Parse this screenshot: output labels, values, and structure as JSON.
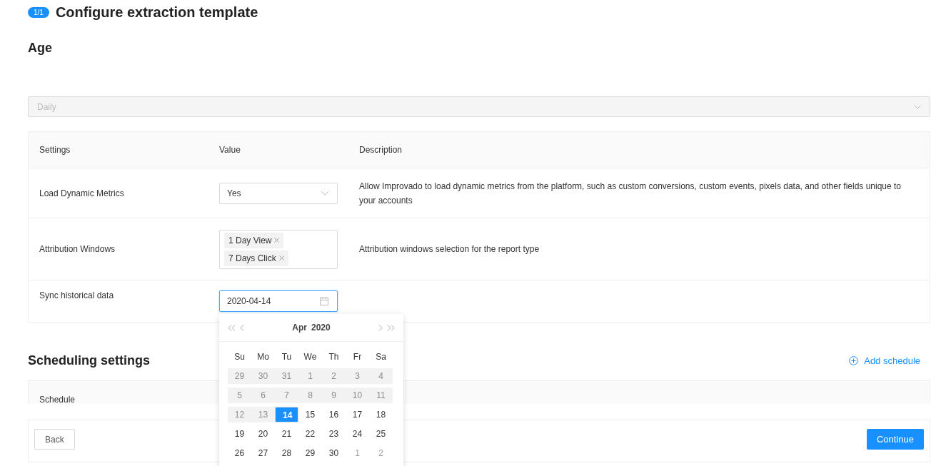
{
  "header": {
    "badge": "1/1",
    "title": "Configure extraction template"
  },
  "section_title": "Age",
  "frequency_select": {
    "value": "Daily",
    "disabled": true
  },
  "settings_table": {
    "columns": [
      "Settings",
      "Value",
      "Description"
    ],
    "rows": [
      {
        "kind": "select",
        "setting": "Load Dynamic Metrics",
        "value": "Yes",
        "description": "Allow Improvado to load dynamic metrics from the platform, such as custom conversions, custom events, pixels data, and other fields unique to your accounts"
      },
      {
        "kind": "tags",
        "setting": "Attribution Windows",
        "tags": [
          "1 Day View",
          "7 Days Click"
        ],
        "description": "Attribution windows selection for the report type"
      },
      {
        "kind": "date",
        "setting": "Sync historical data",
        "value": "2020-04-14"
      }
    ]
  },
  "date_picker": {
    "month": "Apr",
    "year": "2020",
    "weekdays": [
      "Su",
      "Mo",
      "Tu",
      "We",
      "Th",
      "Fr",
      "Sa"
    ],
    "weeks": [
      [
        {
          "day": "29",
          "disabled": true,
          "selected": false
        },
        {
          "day": "30",
          "disabled": true,
          "selected": false
        },
        {
          "day": "31",
          "disabled": true,
          "selected": false
        },
        {
          "day": "1",
          "disabled": true,
          "selected": false
        },
        {
          "day": "2",
          "disabled": true,
          "selected": false
        },
        {
          "day": "3",
          "disabled": true,
          "selected": false
        },
        {
          "day": "4",
          "disabled": true,
          "selected": false
        }
      ],
      [
        {
          "day": "5",
          "disabled": true,
          "selected": false
        },
        {
          "day": "6",
          "disabled": true,
          "selected": false
        },
        {
          "day": "7",
          "disabled": true,
          "selected": false
        },
        {
          "day": "8",
          "disabled": true,
          "selected": false
        },
        {
          "day": "9",
          "disabled": true,
          "selected": false
        },
        {
          "day": "10",
          "disabled": true,
          "selected": false
        },
        {
          "day": "11",
          "disabled": true,
          "selected": false
        }
      ],
      [
        {
          "day": "12",
          "disabled": true,
          "selected": false
        },
        {
          "day": "13",
          "disabled": true,
          "selected": false
        },
        {
          "day": "14",
          "disabled": false,
          "other_month": false,
          "selected": true
        },
        {
          "day": "15",
          "disabled": false,
          "other_month": false,
          "selected": false
        },
        {
          "day": "16",
          "disabled": false,
          "other_month": false,
          "selected": false
        },
        {
          "day": "17",
          "disabled": false,
          "other_month": false,
          "selected": false
        },
        {
          "day": "18",
          "disabled": false,
          "other_month": false,
          "selected": false
        }
      ],
      [
        {
          "day": "19",
          "disabled": false,
          "other_month": false,
          "selected": false
        },
        {
          "day": "20",
          "disabled": false,
          "other_month": false,
          "selected": false
        },
        {
          "day": "21",
          "disabled": false,
          "other_month": false,
          "selected": false
        },
        {
          "day": "22",
          "disabled": false,
          "other_month": false,
          "selected": false
        },
        {
          "day": "23",
          "disabled": false,
          "other_month": false,
          "selected": false
        },
        {
          "day": "24",
          "disabled": false,
          "other_month": false,
          "selected": false
        },
        {
          "day": "25",
          "disabled": false,
          "other_month": false,
          "selected": false
        }
      ],
      [
        {
          "day": "26",
          "disabled": false,
          "other_month": false,
          "selected": false
        },
        {
          "day": "27",
          "disabled": false,
          "other_month": false,
          "selected": false
        },
        {
          "day": "28",
          "disabled": false,
          "other_month": false,
          "selected": false
        },
        {
          "day": "29",
          "disabled": false,
          "other_month": false,
          "selected": false
        },
        {
          "day": "30",
          "disabled": false,
          "other_month": false,
          "selected": false
        },
        {
          "day": "1",
          "disabled": false,
          "other_month": true,
          "selected": false
        },
        {
          "day": "2",
          "disabled": false,
          "other_month": true,
          "selected": false
        }
      ]
    ]
  },
  "scheduling": {
    "title": "Scheduling settings",
    "add_button": "Add schedule",
    "columns": [
      "Schedule"
    ]
  },
  "footer": {
    "back": "Back",
    "continue": "Continue"
  }
}
